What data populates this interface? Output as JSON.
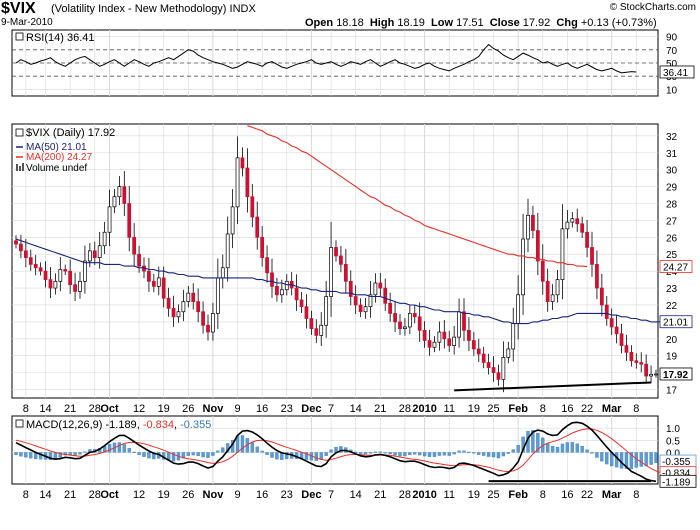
{
  "header": {
    "symbol": "$VIX",
    "name": "(Volatility Index - New Methodology)",
    "exchange": "INDX",
    "date": "9-Mar-2010",
    "credit": "© StockCharts.com",
    "open_label": "Open",
    "open": "18.18",
    "high_label": "High",
    "high": "18.19",
    "low_label": "Low",
    "low": "17.51",
    "close_label": "Close",
    "close": "17.92",
    "chg_label": "Chg",
    "chg": "+0.13 (+0.73%)"
  },
  "colors": {
    "up": "#ffffff",
    "down": "#cc1133",
    "ma50": "#1a237e",
    "ma200": "#e8302a",
    "rsi": "#000000",
    "hist": "#5b9bd5",
    "signal": "#e8302a",
    "grid": "#d8d8d8"
  },
  "chart_data": [
    {
      "type": "line",
      "panel": "rsi",
      "label": "RSI(14) 36.41",
      "ylim": [
        0,
        100
      ],
      "y_ticks": [
        10,
        30,
        50,
        70,
        90
      ],
      "last_label": "36.41",
      "values": [
        50,
        55,
        52,
        48,
        50,
        53,
        55,
        58,
        52,
        48,
        45,
        50,
        55,
        58,
        60,
        55,
        50,
        45,
        48,
        52,
        55,
        50,
        45,
        50,
        55,
        52,
        48,
        45,
        50,
        52,
        55,
        58,
        55,
        60,
        65,
        70,
        68,
        62,
        58,
        55,
        52,
        50,
        48,
        45,
        42,
        44,
        48,
        52,
        50,
        48,
        45,
        50,
        52,
        48,
        44,
        42,
        45,
        48,
        50,
        52,
        55,
        50,
        48,
        50,
        52,
        48,
        45,
        48,
        52,
        50,
        48,
        52,
        55,
        50,
        45,
        48,
        52,
        55,
        50,
        48,
        45,
        42,
        44,
        48,
        50,
        45,
        42,
        40,
        38,
        42,
        45,
        48,
        52,
        55,
        60,
        70,
        78,
        72,
        68,
        62,
        58,
        55,
        60,
        65,
        62,
        58,
        55,
        50,
        52,
        48,
        45,
        48,
        50,
        45,
        42,
        45,
        48,
        44,
        40,
        38,
        40,
        42,
        38,
        35,
        36,
        37,
        36.41
      ]
    },
    {
      "type": "candlestick",
      "panel": "price",
      "label": "$VIX (Daily) 17.92",
      "ma50_label": "MA(50) 21.01",
      "ma200_label": "MA(200) 24.27",
      "volume_label": "Volume undef",
      "ylim": [
        16.5,
        32.7
      ],
      "y_ticks": [
        17,
        18,
        19,
        20,
        21,
        22,
        23,
        24,
        25,
        26,
        27,
        28,
        29,
        30,
        31,
        32
      ],
      "last_close": "17.92",
      "ma50_last": "21.01",
      "ma200_last": "24.27",
      "closes": [
        25.6,
        25.2,
        24.8,
        24.4,
        24.2,
        24.0,
        23.5,
        23.0,
        23.4,
        24.1,
        24.0,
        23.2,
        22.8,
        23.4,
        24.6,
        25.2,
        24.8,
        25.5,
        26.3,
        27.8,
        28.4,
        29.0,
        28.0,
        26.0,
        25.0,
        24.3,
        24.0,
        23.4,
        23.1,
        23.6,
        22.4,
        21.8,
        21.3,
        21.6,
        22.2,
        22.7,
        22.2,
        21.6,
        20.8,
        20.4,
        21.5,
        23.6,
        24.2,
        26.2,
        27.8,
        30.7,
        30.1,
        28.4,
        27.2,
        26.0,
        24.8,
        23.9,
        23.1,
        22.6,
        22.9,
        23.4,
        23.0,
        22.3,
        21.9,
        21.2,
        20.6,
        20.2,
        20.8,
        22.5,
        25.4,
        24.9,
        24.4,
        23.4,
        22.5,
        22.0,
        21.6,
        21.9,
        22.6,
        23.3,
        23.0,
        22.1,
        21.5,
        21.0,
        20.6,
        20.7,
        21.5,
        21.3,
        20.5,
        19.9,
        19.5,
        19.8,
        20.4,
        20.0,
        19.6,
        20.1,
        21.6,
        20.5,
        19.9,
        19.4,
        19.1,
        18.6,
        18.3,
        18.0,
        17.6,
        18.9,
        19.4,
        20.9,
        22.6,
        25.9,
        27.3,
        26.4,
        24.6,
        23.4,
        22.2,
        22.6,
        23.5,
        26.5,
        26.9,
        27.1,
        26.8,
        26.3,
        25.4,
        24.4,
        23.0,
        22.0,
        21.2,
        20.7,
        20.3,
        19.6,
        19.2,
        18.7,
        18.6,
        18.5,
        17.8,
        17.9,
        17.92
      ],
      "ma50": [
        25.9,
        25.8,
        25.7,
        25.6,
        25.5,
        25.4,
        25.3,
        25.2,
        25.1,
        25.0,
        24.9,
        24.8,
        24.7,
        24.6,
        24.5,
        24.5,
        24.5,
        24.5,
        24.4,
        24.4,
        24.4,
        24.4,
        24.3,
        24.3,
        24.3,
        24.2,
        24.2,
        24.1,
        24.1,
        24.0,
        24.0,
        23.9,
        23.9,
        23.8,
        23.8,
        23.7,
        23.7,
        23.7,
        23.6,
        23.6,
        23.6,
        23.6,
        23.6,
        23.6,
        23.6,
        23.6,
        23.6,
        23.6,
        23.6,
        23.5,
        23.5,
        23.4,
        23.4,
        23.3,
        23.3,
        23.2,
        23.2,
        23.1,
        23.0,
        23.0,
        22.9,
        22.9,
        22.8,
        22.8,
        22.8,
        22.8,
        22.7,
        22.7,
        22.7,
        22.6,
        22.6,
        22.6,
        22.5,
        22.5,
        22.5,
        22.4,
        22.3,
        22.2,
        22.1,
        22.1,
        22.0,
        22.0,
        21.9,
        21.9,
        21.8,
        21.7,
        21.7,
        21.6,
        21.6,
        21.6,
        21.6,
        21.5,
        21.5,
        21.4,
        21.4,
        21.3,
        21.3,
        21.2,
        21.1,
        21.0,
        21.0,
        20.9,
        20.9,
        20.9,
        20.9,
        21.0,
        21.0,
        21.1,
        21.1,
        21.2,
        21.2,
        21.3,
        21.3,
        21.4,
        21.5,
        21.5,
        21.5,
        21.5,
        21.5,
        21.5,
        21.5,
        21.4,
        21.4,
        21.3,
        21.3,
        21.2,
        21.2,
        21.1,
        21.1,
        21.0,
        21.0,
        21.01
      ],
      "ma200": [
        null,
        null,
        null,
        null,
        null,
        null,
        null,
        null,
        null,
        null,
        null,
        null,
        null,
        null,
        null,
        null,
        null,
        null,
        null,
        null,
        null,
        null,
        null,
        null,
        null,
        null,
        null,
        null,
        null,
        null,
        null,
        null,
        null,
        null,
        null,
        null,
        null,
        null,
        null,
        null,
        null,
        null,
        null,
        null,
        null,
        null,
        null,
        32.6,
        32.5,
        32.4,
        32.3,
        32.1,
        32.0,
        31.9,
        31.7,
        31.6,
        31.4,
        31.3,
        31.1,
        31.0,
        30.8,
        30.6,
        30.4,
        30.2,
        30.0,
        29.8,
        29.6,
        29.4,
        29.2,
        29.0,
        28.8,
        28.6,
        28.4,
        28.3,
        28.1,
        27.9,
        27.8,
        27.6,
        27.5,
        27.3,
        27.2,
        27.0,
        26.9,
        26.7,
        26.6,
        26.5,
        26.4,
        26.3,
        26.2,
        26.1,
        26.0,
        25.9,
        25.8,
        25.7,
        25.6,
        25.5,
        25.4,
        25.3,
        25.2,
        25.1,
        25.0,
        25.0,
        24.9,
        24.9,
        24.8,
        24.8,
        24.7,
        24.7,
        24.6,
        24.6,
        24.5,
        24.5,
        24.4,
        24.4,
        24.3,
        24.3,
        24.27
      ]
    },
    {
      "type": "bar",
      "panel": "macd",
      "label_prefix": "MACD(12,26,9)",
      "macd_value": "-1.189",
      "signal_value": "-0.834",
      "hist_value": "-0.355",
      "ylim": [
        -1.3,
        1.5
      ],
      "y_ticks": [
        1.0,
        0.5,
        0.0
      ],
      "last_labels": [
        "-0.355",
        "-0.834",
        "-1.189"
      ],
      "macd": [
        0.4,
        0.3,
        0.2,
        0.1,
        0.0,
        -0.08,
        -0.16,
        -0.24,
        -0.28,
        -0.26,
        -0.2,
        -0.22,
        -0.26,
        -0.24,
        -0.12,
        0.0,
        0.04,
        0.14,
        0.28,
        0.44,
        0.58,
        0.7,
        0.7,
        0.58,
        0.44,
        0.3,
        0.18,
        0.06,
        -0.04,
        -0.08,
        -0.2,
        -0.32,
        -0.44,
        -0.48,
        -0.46,
        -0.4,
        -0.4,
        -0.46,
        -0.56,
        -0.64,
        -0.58,
        -0.36,
        -0.18,
        0.08,
        0.34,
        0.7,
        0.88,
        0.9,
        0.84,
        0.72,
        0.56,
        0.38,
        0.22,
        0.08,
        -0.02,
        -0.06,
        -0.1,
        -0.18,
        -0.26,
        -0.36,
        -0.46,
        -0.56,
        -0.58,
        -0.46,
        -0.18,
        -0.02,
        0.08,
        0.08,
        0.02,
        -0.06,
        -0.14,
        -0.18,
        -0.16,
        -0.1,
        -0.08,
        -0.12,
        -0.18,
        -0.26,
        -0.34,
        -0.38,
        -0.36,
        -0.36,
        -0.42,
        -0.5,
        -0.58,
        -0.62,
        -0.6,
        -0.62,
        -0.66,
        -0.62,
        -0.46,
        -0.44,
        -0.48,
        -0.54,
        -0.62,
        -0.7,
        -0.78,
        -0.86,
        -0.96,
        -0.92,
        -0.84,
        -0.64,
        -0.38,
        0.12,
        0.58,
        0.84,
        0.92,
        0.88,
        0.76,
        0.7,
        0.72,
        0.94,
        1.1,
        1.22,
        1.24,
        1.2,
        1.08,
        0.92,
        0.7,
        0.46,
        0.22,
        0.0,
        -0.2,
        -0.42,
        -0.6,
        -0.78,
        -0.88,
        -0.98,
        -1.1,
        -1.16,
        -1.189
      ],
      "signal": [
        0.5,
        0.46,
        0.4,
        0.34,
        0.27,
        0.2,
        0.13,
        0.06,
        0.0,
        -0.05,
        -0.08,
        -0.11,
        -0.14,
        -0.16,
        -0.15,
        -0.12,
        -0.09,
        -0.04,
        0.02,
        0.1,
        0.19,
        0.29,
        0.37,
        0.41,
        0.42,
        0.4,
        0.36,
        0.3,
        0.23,
        0.17,
        0.09,
        0.01,
        -0.08,
        -0.16,
        -0.22,
        -0.26,
        -0.29,
        -0.32,
        -0.37,
        -0.42,
        -0.45,
        -0.43,
        -0.38,
        -0.29,
        -0.16,
        0.01,
        0.18,
        0.32,
        0.43,
        0.49,
        0.5,
        0.48,
        0.43,
        0.36,
        0.28,
        0.21,
        0.15,
        0.08,
        0.01,
        -0.06,
        -0.14,
        -0.22,
        -0.29,
        -0.32,
        -0.29,
        -0.24,
        -0.17,
        -0.12,
        -0.09,
        -0.08,
        -0.09,
        -0.11,
        -0.12,
        -0.12,
        -0.11,
        -0.11,
        -0.12,
        -0.15,
        -0.19,
        -0.23,
        -0.26,
        -0.28,
        -0.31,
        -0.35,
        -0.4,
        -0.44,
        -0.47,
        -0.5,
        -0.53,
        -0.55,
        -0.53,
        -0.51,
        -0.5,
        -0.51,
        -0.53,
        -0.57,
        -0.61,
        -0.67,
        -0.73,
        -0.77,
        -0.79,
        -0.76,
        -0.68,
        -0.52,
        -0.3,
        -0.07,
        0.13,
        0.28,
        0.38,
        0.44,
        0.5,
        0.59,
        0.69,
        0.8,
        0.88,
        0.94,
        0.97,
        0.96,
        0.91,
        0.82,
        0.7,
        0.56,
        0.41,
        0.24,
        0.07,
        -0.1,
        -0.26,
        -0.4,
        -0.54,
        -0.66,
        -0.76,
        -0.834
      ]
    }
  ],
  "x_axis": {
    "ticks": [
      {
        "label": "8",
        "i": 2
      },
      {
        "label": "14",
        "i": 6
      },
      {
        "label": "21",
        "i": 11
      },
      {
        "label": "28",
        "i": 16
      },
      {
        "label": "Oct",
        "i": 19,
        "bold": true
      },
      {
        "label": "12",
        "i": 25
      },
      {
        "label": "19",
        "i": 30
      },
      {
        "label": "26",
        "i": 35
      },
      {
        "label": "Nov",
        "i": 40,
        "bold": true
      },
      {
        "label": "9",
        "i": 45
      },
      {
        "label": "16",
        "i": 50
      },
      {
        "label": "23",
        "i": 55
      },
      {
        "label": "Dec",
        "i": 60,
        "bold": true
      },
      {
        "label": "7",
        "i": 64
      },
      {
        "label": "14",
        "i": 69
      },
      {
        "label": "21",
        "i": 74
      },
      {
        "label": "28",
        "i": 79
      },
      {
        "label": "2010",
        "i": 83,
        "bold": true
      },
      {
        "label": "11",
        "i": 88
      },
      {
        "label": "19",
        "i": 93
      },
      {
        "label": "25",
        "i": 97
      },
      {
        "label": "Feb",
        "i": 102,
        "bold": true
      },
      {
        "label": "8",
        "i": 107
      },
      {
        "label": "16",
        "i": 112
      },
      {
        "label": "22",
        "i": 116
      },
      {
        "label": "Mar",
        "i": 121,
        "bold": true
      },
      {
        "label": "8",
        "i": 126
      }
    ]
  }
}
